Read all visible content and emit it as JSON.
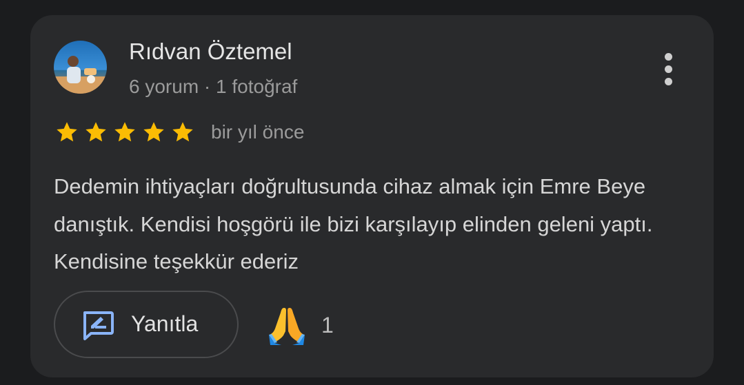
{
  "review": {
    "author_name": "Rıdvan Öztemel",
    "author_meta": "6 yorum · 1 fotoğraf",
    "rating": 5,
    "rating_max": 5,
    "time_ago": "bir yıl önce",
    "text": "Dedemin ihtiyaçları doğrultusunda cihaz almak için Emre Beye danıştık. Kendisi hoşgörü ile bizi karşılayıp elinden geleni yaptı. Kendisine teşekkür ederiz",
    "reply_label": "Yanıtla",
    "reaction_icon": "folded-hands-icon",
    "reaction_count": "1"
  },
  "icons": {
    "avatar": "avatar-photo",
    "more": "more-vert-icon",
    "star": "star-icon",
    "reply": "rate-review-icon"
  },
  "colors": {
    "background": "#1b1c1e",
    "card": "#292a2c",
    "star": "#fbbc04",
    "reply_icon": "#8ab4f8",
    "primary_text": "#e6e6e6",
    "secondary_text": "#9b9b9b"
  }
}
